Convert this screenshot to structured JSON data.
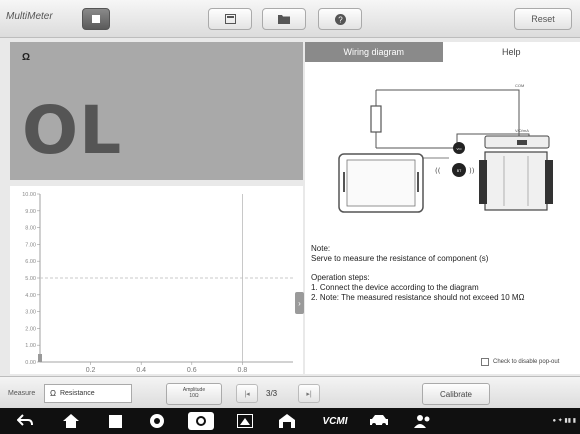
{
  "app": {
    "title": "MultiMeter"
  },
  "toolbar": {
    "reset_label": "Reset"
  },
  "reading": {
    "unit": "Ω",
    "value": "OL"
  },
  "chart_data": {
    "type": "line",
    "x_ticks": [
      "0.2",
      "0.4",
      "0.6",
      "0.8"
    ],
    "y_ticks": [
      "10.00",
      "9.00",
      "8.00",
      "7.00",
      "6.00",
      "5.00",
      "4.00",
      "3.00",
      "2.00",
      "1.00",
      "0.00"
    ],
    "xlim": [
      0,
      1
    ],
    "ylim": [
      0,
      10
    ],
    "reference_line_y": 5,
    "cursor_x": 0.8,
    "grid": true,
    "series": []
  },
  "tabs": [
    {
      "label": "Wiring diagram",
      "active": true
    },
    {
      "label": "Help",
      "active": false
    }
  ],
  "help": {
    "note_title": "Note:",
    "note_text": "Serve to measure the resistance of component (s)",
    "steps_title": "Operation steps:",
    "step1": "1. Connect the device according to the diagram",
    "step2": "2. Note: The measured resistance should not exceed 10 MΩ",
    "disable_popup": "Check to disable pop-out"
  },
  "controls": {
    "measure_label": "Measure",
    "measure_symbol": "Ω",
    "measure_value": "Resistance",
    "amplitude_label": "Amplitude",
    "amplitude_value": "10Ω",
    "page": "3/3",
    "calibrate_label": "Calibrate"
  },
  "navbar": {
    "vci_label": "VCMI"
  },
  "colors": {
    "panel_gray": "#a9a9a9",
    "tab_active": "#8a8a8a",
    "ref_line": "#c9c9c9"
  }
}
